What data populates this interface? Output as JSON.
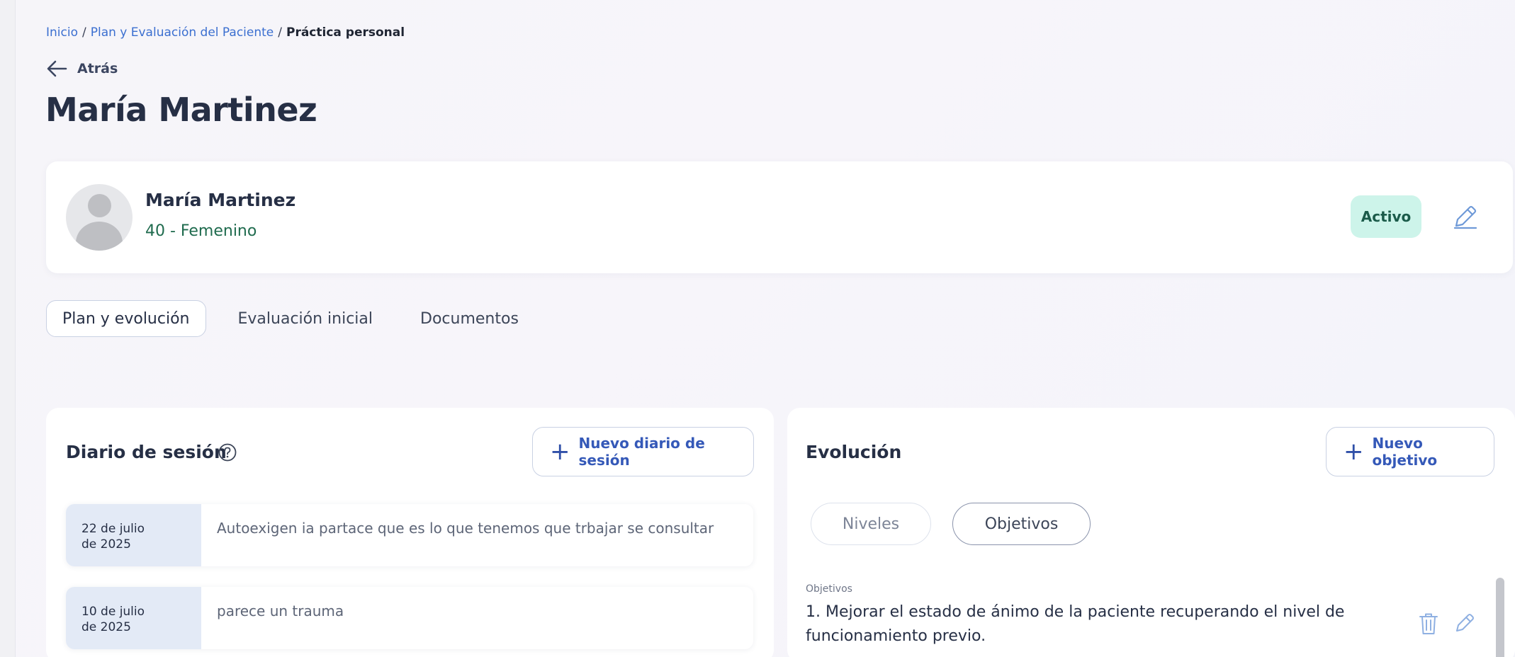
{
  "breadcrumb": {
    "home": "Inicio",
    "sep1": "/",
    "section": "Plan y Evaluación del Paciente",
    "sep2": "/",
    "current": "Práctica personal"
  },
  "back": {
    "label": "Atrás",
    "icon": "arrow-left-icon"
  },
  "page_title": "María Martinez",
  "patient": {
    "name": "María Martinez",
    "info": "40 - Femenino",
    "status": "Activo",
    "status_color": "#cdf4ea"
  },
  "tabs": [
    {
      "label": "Plan y evolución",
      "active": true
    },
    {
      "label": "Evaluación inicial",
      "active": false
    },
    {
      "label": "Documentos",
      "active": false
    }
  ],
  "session_diary": {
    "title": "Diario de sesión",
    "new_button": "Nuevo diario de sesión",
    "entries": [
      {
        "date_line1": "22 de julio",
        "date_line2": "de 2025",
        "text": "Autoexigen ia partace que es lo que tenemos que trbajar se consultar"
      },
      {
        "date_line1": "10 de julio",
        "date_line2": "de 2025",
        "text": "parece un trauma"
      }
    ]
  },
  "evolution": {
    "title": "Evolución",
    "new_button": "Nuevo objetivo",
    "segments": [
      {
        "label": "Niveles",
        "active": false
      },
      {
        "label": "Objetivos",
        "active": true
      }
    ],
    "objectives_label": "Objetivos",
    "objectives": [
      "1. Mejorar el estado de ánimo de la paciente recuperando el nivel de funcionamiento previo."
    ]
  },
  "colors": {
    "accent": "#3559b8",
    "link": "#3b6fd0",
    "info_green": "#1f6b4e",
    "date_bg": "#e3eaf6"
  }
}
